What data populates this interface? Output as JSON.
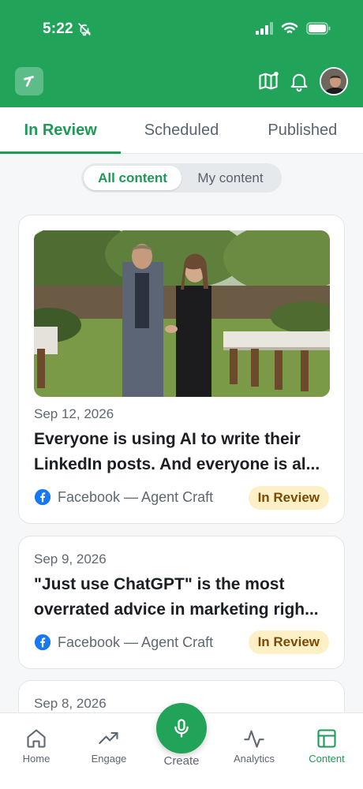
{
  "status_bar": {
    "time": "5:22"
  },
  "tabs": [
    {
      "label": "In Review",
      "active": true
    },
    {
      "label": "Scheduled",
      "active": false
    },
    {
      "label": "Published",
      "active": false
    }
  ],
  "filter": {
    "all": "All content",
    "mine": "My content",
    "selected": "All content"
  },
  "posts": [
    {
      "date": "Sep 12, 2026",
      "title_line1": "Everyone is using AI to write their",
      "title_line2": "LinkedIn posts. And everyone is al...",
      "source": "Facebook — Agent Craft",
      "status": "In Review",
      "has_image": true
    },
    {
      "date": "Sep 9, 2026",
      "title_line1": "\"Just use ChatGPT\" is the most",
      "title_line2": "overrated advice in marketing righ...",
      "source": "Facebook — Agent Craft",
      "status": "In Review",
      "has_image": false
    },
    {
      "date": "Sep 8, 2026"
    }
  ],
  "nav": {
    "home": "Home",
    "engage": "Engage",
    "create": "Create",
    "analytics": "Analytics",
    "content": "Content",
    "active": "Content"
  },
  "colors": {
    "brand_green": "#21a35a",
    "accent_green": "#1d9a55",
    "badge_bg": "#fdf0c6",
    "badge_text": "#7a4a06",
    "facebook_blue": "#1877f2"
  },
  "icons": [
    "bell-off-icon",
    "signal-icon",
    "wifi-icon",
    "battery-icon",
    "app-logo-icon",
    "map-icon",
    "notification-bell-icon",
    "avatar",
    "facebook-icon",
    "home-icon",
    "trending-up-icon",
    "microphone-icon",
    "activity-icon",
    "layout-icon"
  ]
}
